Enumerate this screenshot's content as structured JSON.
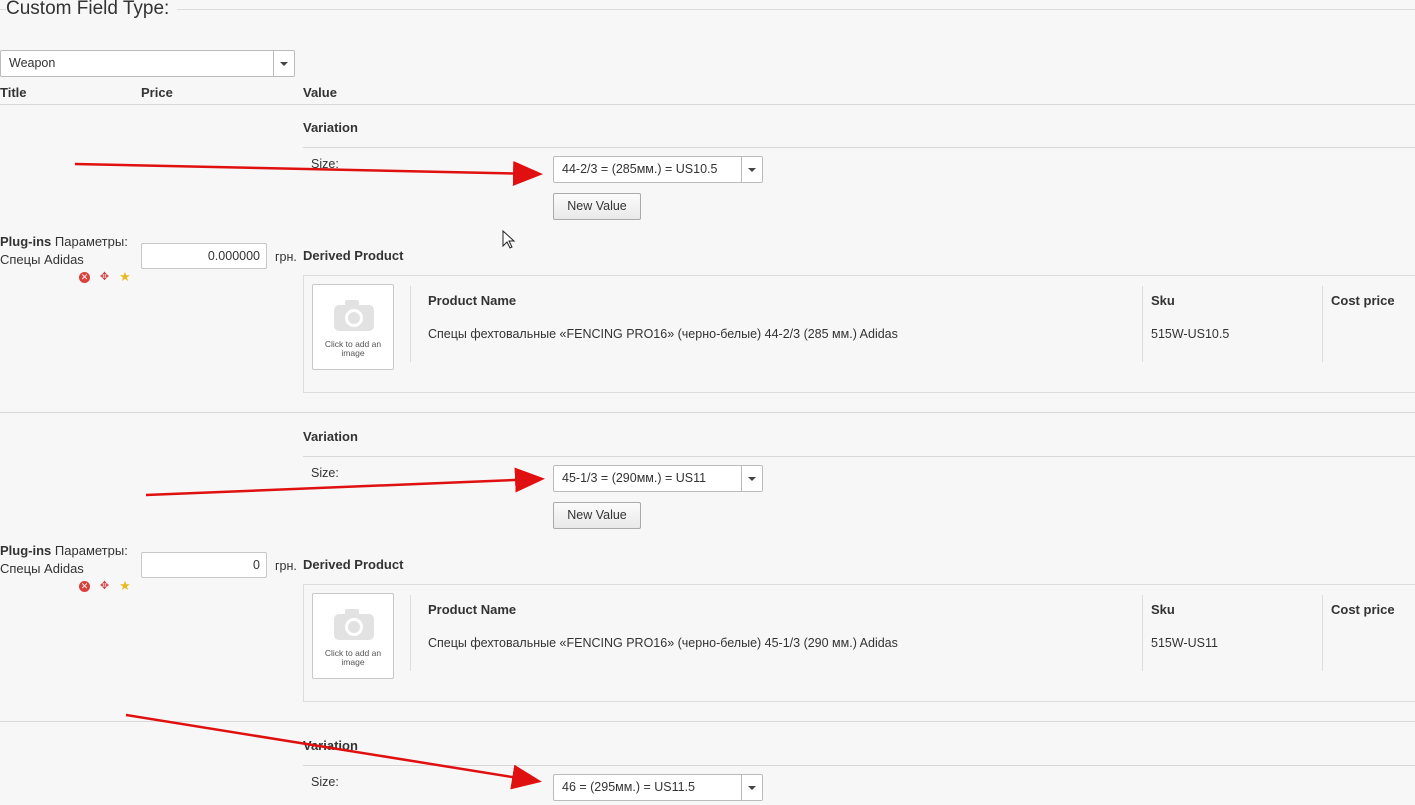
{
  "fieldset": {
    "legend": "Custom Field Type:"
  },
  "type_select": {
    "value": "Weapon"
  },
  "columns": {
    "title": "Title",
    "price": "Price",
    "value": "Value"
  },
  "rows": [
    {
      "title_bold": "Plug-ins",
      "title_rest": "Параметры:",
      "title_line2": "Спецы Adidas",
      "price": "0.000000",
      "currency": "грн.",
      "variation_label": "Variation",
      "size_label": "Size:",
      "size_value": "44-2/3 = (285мм.) = US10.5",
      "new_value_label": "New Value",
      "derived_label": "Derived Product",
      "image_caption": "Click to add an image",
      "product_name_header": "Product Name",
      "sku_header": "Sku",
      "cost_header": "Cost price",
      "product_name": "Спецы фехтовальные «FENCING PRO16» (черно-белые) 44-2/3 (285 мм.) Adidas",
      "sku": "515W-US10.5"
    },
    {
      "title_bold": "Plug-ins",
      "title_rest": "Параметры:",
      "title_line2": "Спецы Adidas",
      "price": "0",
      "currency": "грн.",
      "variation_label": "Variation",
      "size_label": "Size:",
      "size_value": "45-1/3 = (290мм.) = US11",
      "new_value_label": "New Value",
      "derived_label": "Derived Product",
      "image_caption": "Click to add an image",
      "product_name_header": "Product Name",
      "sku_header": "Sku",
      "cost_header": "Cost price",
      "product_name": "Спецы фехтовальные «FENCING PRO16» (черно-белые) 45-1/3 (290 мм.) Adidas",
      "sku": "515W-US11"
    },
    {
      "variation_label": "Variation",
      "size_label": "Size:",
      "size_value": "46 = (295мм.) = US11.5"
    }
  ],
  "colors": {
    "arrow": "#e01010",
    "delete": "#d9413c",
    "star": "#e8b920"
  }
}
